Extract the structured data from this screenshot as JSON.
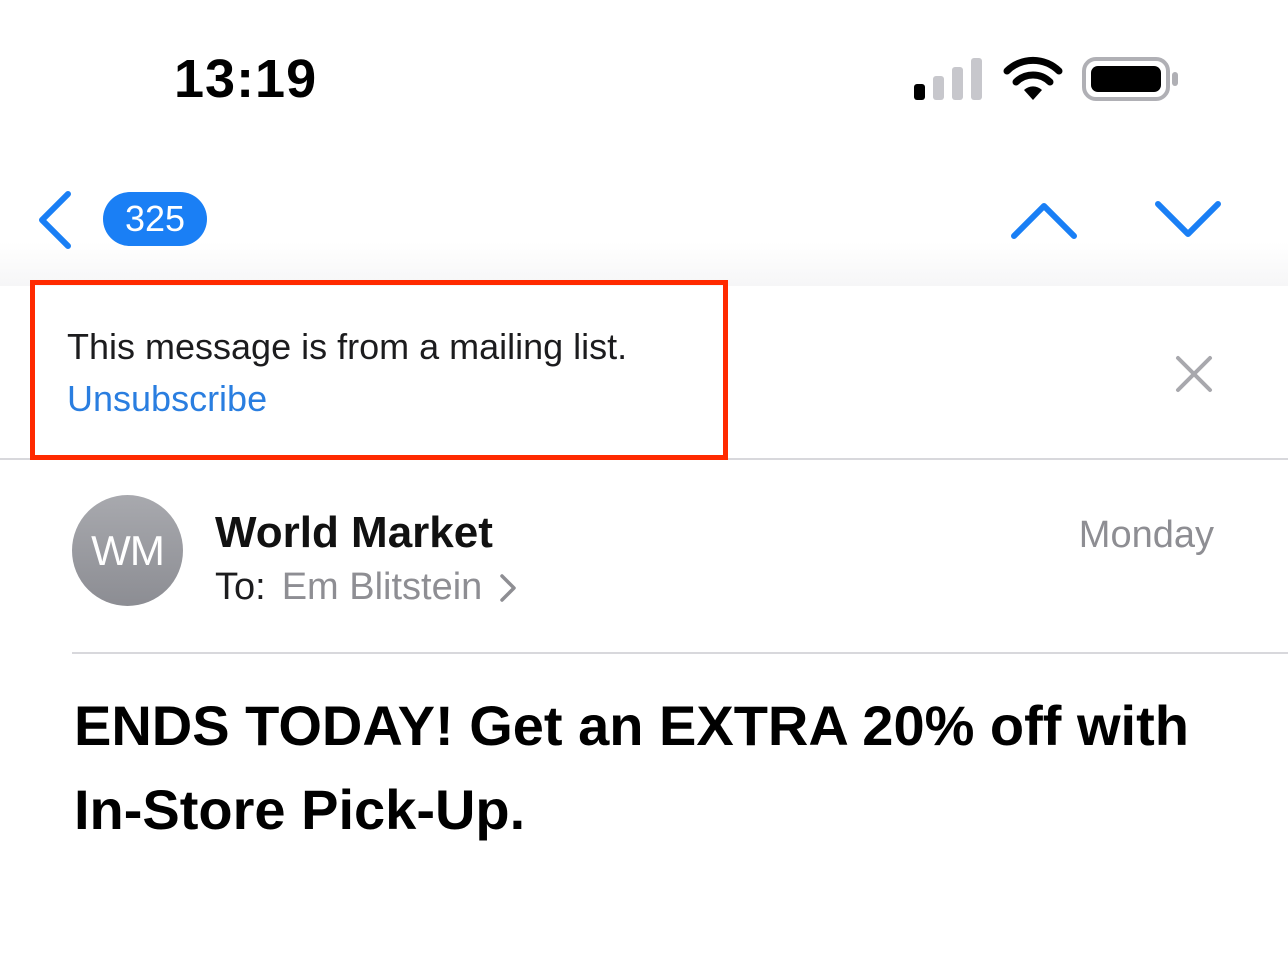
{
  "status_bar": {
    "time": "13:19",
    "signal_icon": "cellular-signal-icon",
    "wifi_icon": "wifi-icon",
    "battery_icon": "battery-icon"
  },
  "nav": {
    "back_icon": "chevron-left-icon",
    "unread_count": "325",
    "prev_icon": "chevron-up-icon",
    "next_icon": "chevron-down-icon",
    "accent_color": "#1a7ff5"
  },
  "banner": {
    "message": "This message is from a mailing list.",
    "unsubscribe_label": "Unsubscribe",
    "close_icon": "close-icon",
    "highlight_color": "#ff2a00"
  },
  "message": {
    "avatar_initials": "WM",
    "sender": "World Market",
    "to_label": "To:",
    "recipient": "Em Blitstein",
    "date": "Monday",
    "subject": "ENDS TODAY! Get an EXTRA 20% off with In-Store Pick-Up."
  }
}
